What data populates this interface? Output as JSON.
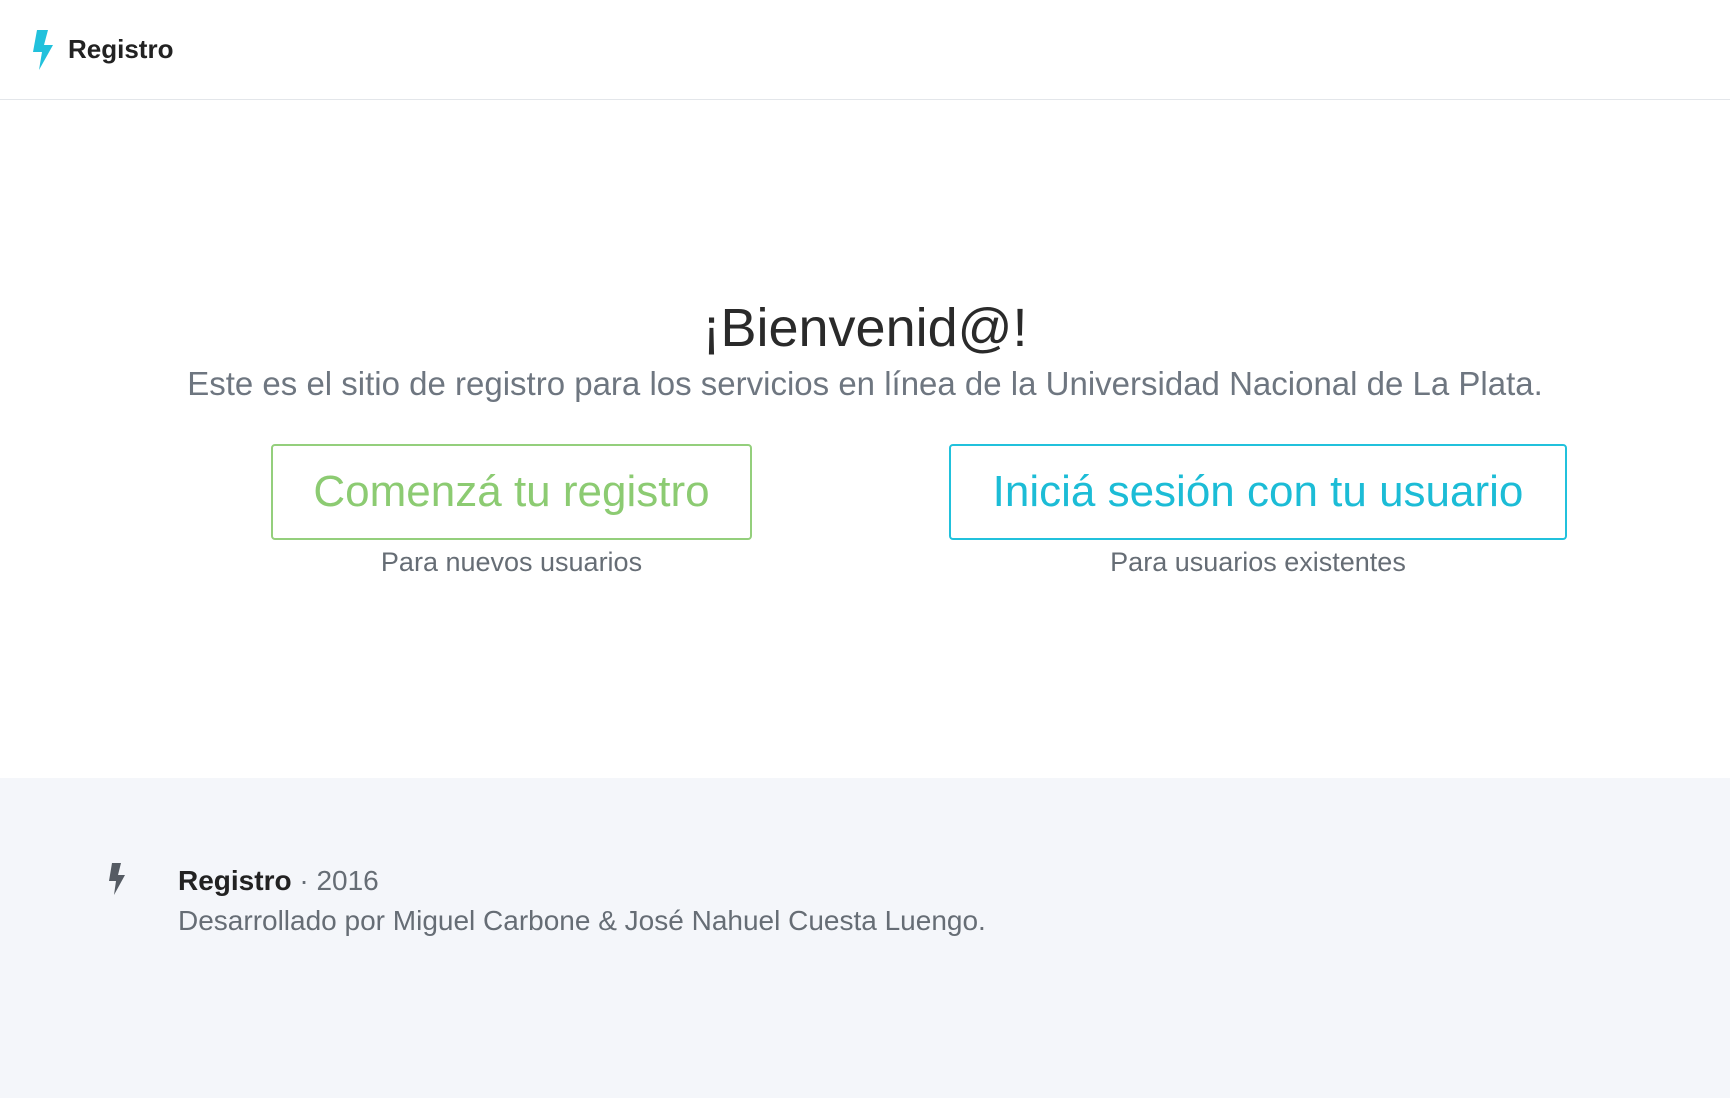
{
  "navbar": {
    "brand_label": "Registro",
    "brand_icon": "lightning-bolt-icon",
    "accent_color": "#21c1dc"
  },
  "hero": {
    "title": "¡Bienvenid@!",
    "subtitle": "Este es el sitio de registro para los servicios en línea de la Universidad Nacional de La Plata."
  },
  "actions": {
    "register": {
      "label": "Comenzá tu registro",
      "caption": "Para nuevos usuarios",
      "color": "#8ccb72"
    },
    "login": {
      "label": "Iniciá sesión con tu usuario",
      "caption": "Para usuarios existentes",
      "color": "#1cbcd6"
    }
  },
  "footer": {
    "brand": "Registro",
    "separator": "·",
    "year": "2016",
    "credits": "Desarrollado por Miguel Carbone & José Nahuel Cuesta Luengo.",
    "icon": "lightning-bolt-icon"
  }
}
